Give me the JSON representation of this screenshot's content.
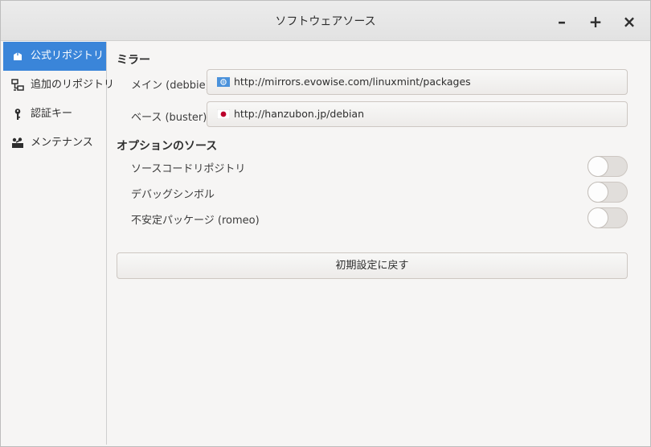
{
  "window": {
    "title": "ソフトウェアソース",
    "minimize": "–",
    "maximize": "+",
    "close": "×"
  },
  "sidebar": {
    "items": [
      {
        "label": "公式リポジトリ",
        "icon": "package-icon",
        "active": true
      },
      {
        "label": "追加のリポジトリ",
        "icon": "network-icon",
        "active": false
      },
      {
        "label": "認証キー",
        "icon": "key-icon",
        "active": false
      },
      {
        "label": "メンテナンス",
        "icon": "maintenance-icon",
        "active": false
      }
    ]
  },
  "mirrors": {
    "heading": "ミラー",
    "main": {
      "label": "メイン (debbie)",
      "url": "http://mirrors.evowise.com/linuxmint/packages",
      "flag": "un-flag-icon"
    },
    "base": {
      "label": "ベース (buster)",
      "url": "http://hanzubon.jp/debian",
      "flag": "japan-flag-icon"
    }
  },
  "options": {
    "heading": "オプションのソース",
    "items": [
      {
        "label": "ソースコードリポジトリ",
        "enabled": false
      },
      {
        "label": "デバッグシンボル",
        "enabled": false
      },
      {
        "label": "不安定パッケージ (romeo)",
        "enabled": false
      }
    ]
  },
  "reset_label": "初期設定に戻す",
  "colors": {
    "accent": "#3a85d9",
    "window_bg": "#f6f5f4",
    "titlebar": "#e6e6e6"
  }
}
